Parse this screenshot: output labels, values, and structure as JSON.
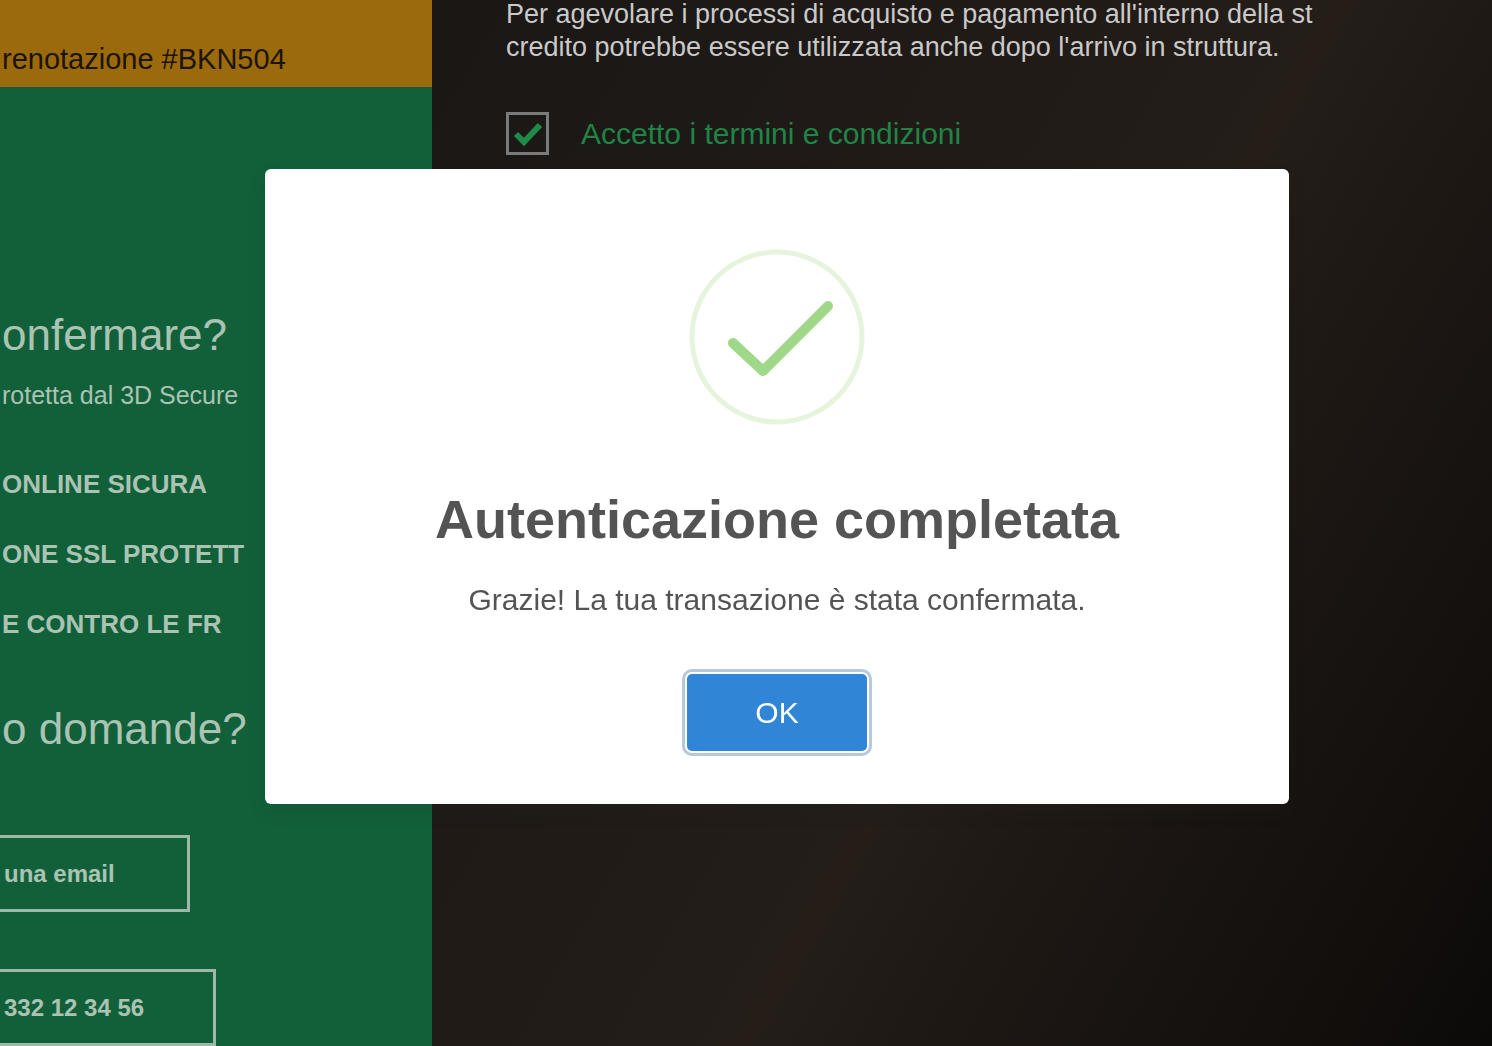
{
  "booking": {
    "title": "renotazione #BKN504"
  },
  "sidebar": {
    "heading": "onfermare?",
    "subtitle": "rotetta dal 3D Secure",
    "features": [
      "ONLINE SICURA",
      "ONE SSL PROTETT",
      "E CONTRO LE FR"
    ],
    "help_heading": "o domande?",
    "buttons": [
      "una email",
      "332 12 34 56"
    ]
  },
  "terms": {
    "text": [
      "Per agevolare i processi di acquisto e pagamento all'interno della st",
      "credito potrebbe essere utilizzata anche dopo l'arrivo in struttura."
    ],
    "checkbox": {
      "label": "Accetto i termini e condizioni",
      "checked": true
    }
  },
  "dialog": {
    "title": "Autenticazione completata",
    "message": "Grazie! La tua transazione è stata confermata.",
    "buttons": [
      "OK"
    ]
  }
}
